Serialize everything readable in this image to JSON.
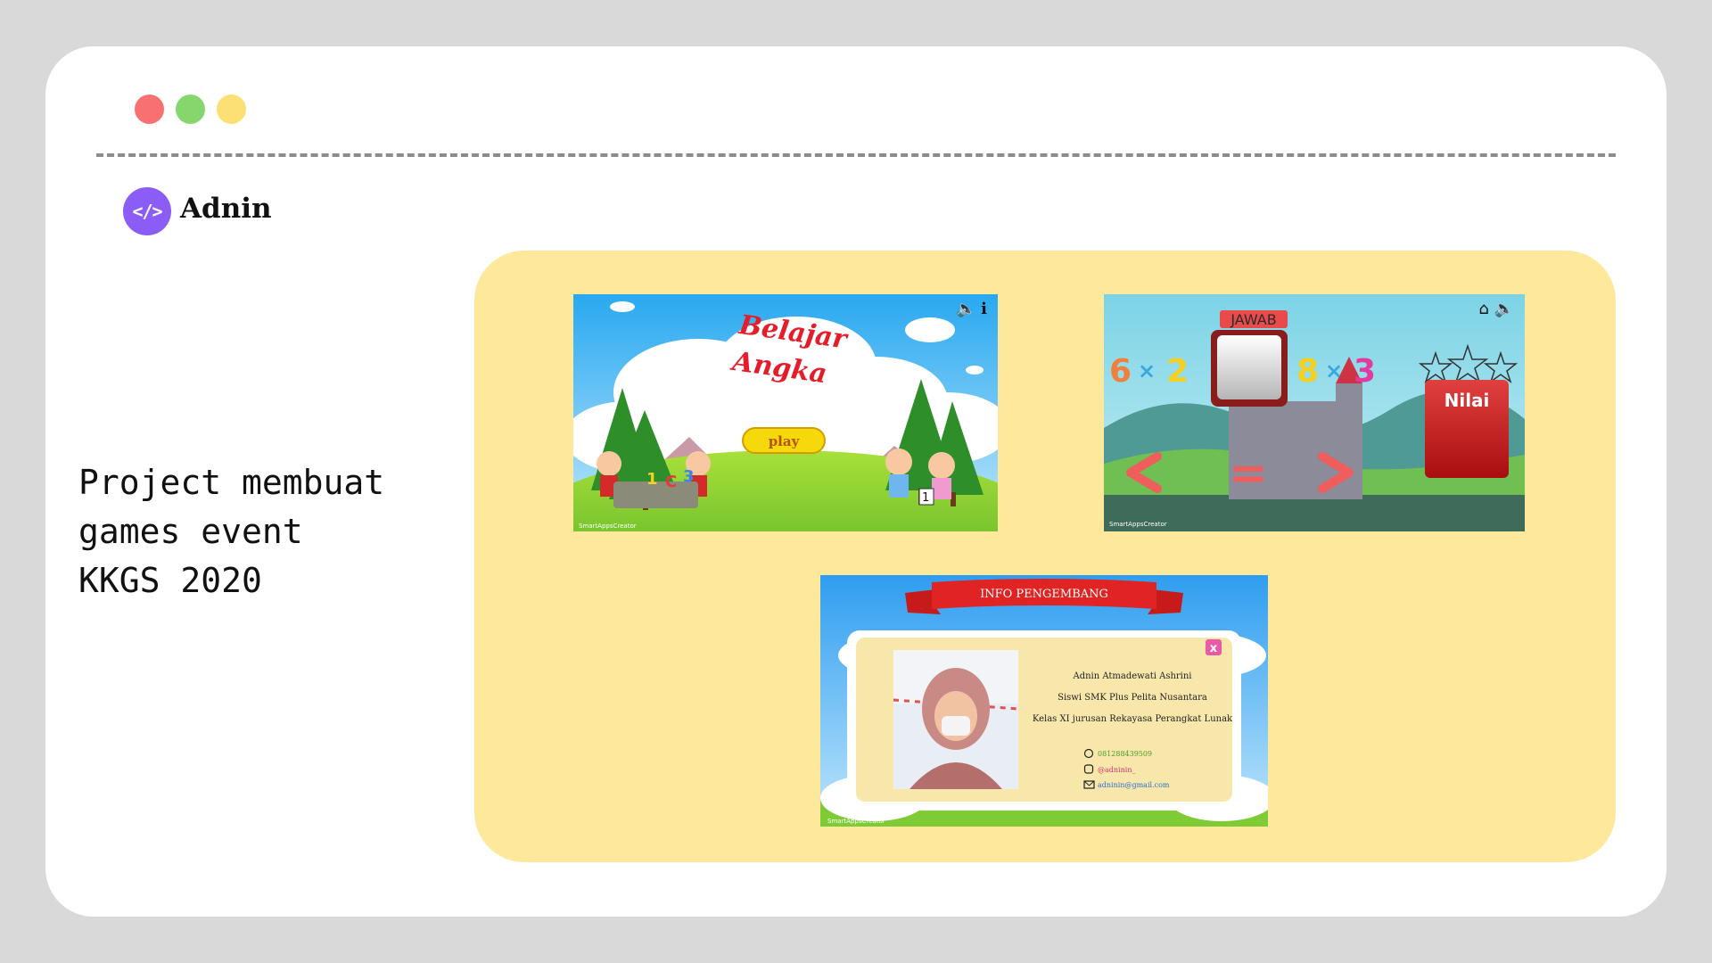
{
  "window": {
    "controls": [
      {
        "name": "close",
        "color": "#f87171"
      },
      {
        "name": "minimize",
        "color": "#86d66e"
      },
      {
        "name": "maximize",
        "color": "#fde073"
      }
    ]
  },
  "header": {
    "logo_icon": "code-icon",
    "logo_text": "</>",
    "brand": "Adnin"
  },
  "project": {
    "lines": [
      "Project membuat",
      "games event",
      "KKGS 2020"
    ]
  },
  "gallery": {
    "background": "#fde89b",
    "screens": [
      {
        "title_line1": "Belajar",
        "title_line2": "Angka",
        "play_label": "play",
        "hud_icons": [
          "speaker-icon",
          "info-icon"
        ],
        "watermark": "SmartAppsCreator"
      },
      {
        "answer_label": "JAWAB",
        "left_operand_a": "6",
        "left_operator": "×",
        "left_operand_b": "2",
        "right_operand_a": "8",
        "right_operator": "×",
        "right_operand_b": "3",
        "equals": "=",
        "score_label": "Nilai",
        "hud_icons": [
          "home-icon",
          "speaker-icon"
        ],
        "watermark": "SmartAppsCreator"
      },
      {
        "banner": "INFO PENGEMBANG",
        "name": "Adnin Atmadewati Ashrini",
        "school": "Siswi SMK Plus Pelita Nusantara",
        "class": "Kelas XI jurusan Rekayasa Perangkat Lunak",
        "phone": "081288439509",
        "instagram": "@adninin_",
        "email": "adninin@gmail.com",
        "close_label": "x",
        "watermark": "SmartAppsCreator"
      }
    ]
  }
}
